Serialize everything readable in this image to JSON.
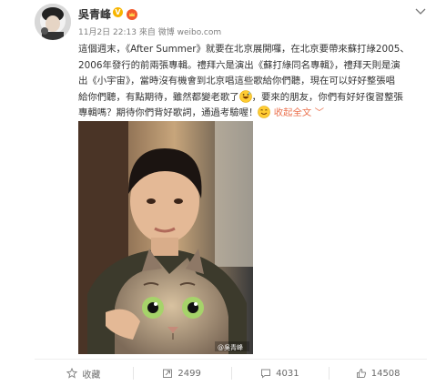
{
  "post": {
    "author": "吳青峰",
    "verified_badge": "V",
    "date": "11月2日 22:13",
    "source": "來自 微博 weibo.com",
    "text_lines": [
      "這個週末，《After Summer》就要在北京展開囉，在北京要帶來蘇打綠2005、",
      "2006年發行的前兩張專輯。禮拜六是演出《蘇打綠同名專輯》，禮拜天則是演",
      "出《小宇宙》，當時沒有機會到北京唱這些歌給你們聽，現在可以好好整張唱",
      "給你們聽，有點期待，雖然都變老歌了",
      "，要來的朋友，你們有好好復習整張",
      "專輯嗎？期待你們背好歌詞，通過考驗喔！",
      "收起全文",
      "﹀"
    ],
    "photo_watermark": "@吳青峰",
    "icons": {
      "more": "chevron-down-icon",
      "emoji_1": "grinning-sweat-emoji",
      "emoji_2": "smile-emoji",
      "collect": "star-icon",
      "repost": "repost-icon",
      "comment": "comment-icon",
      "like": "thumbs-up-icon"
    }
  },
  "actions": {
    "collect_label": "收藏",
    "repost_count": "2499",
    "comment_count": "4031",
    "like_count": "14508"
  },
  "colors": {
    "link": "#eb7350",
    "muted": "#808080",
    "badge": "#f7b500"
  }
}
